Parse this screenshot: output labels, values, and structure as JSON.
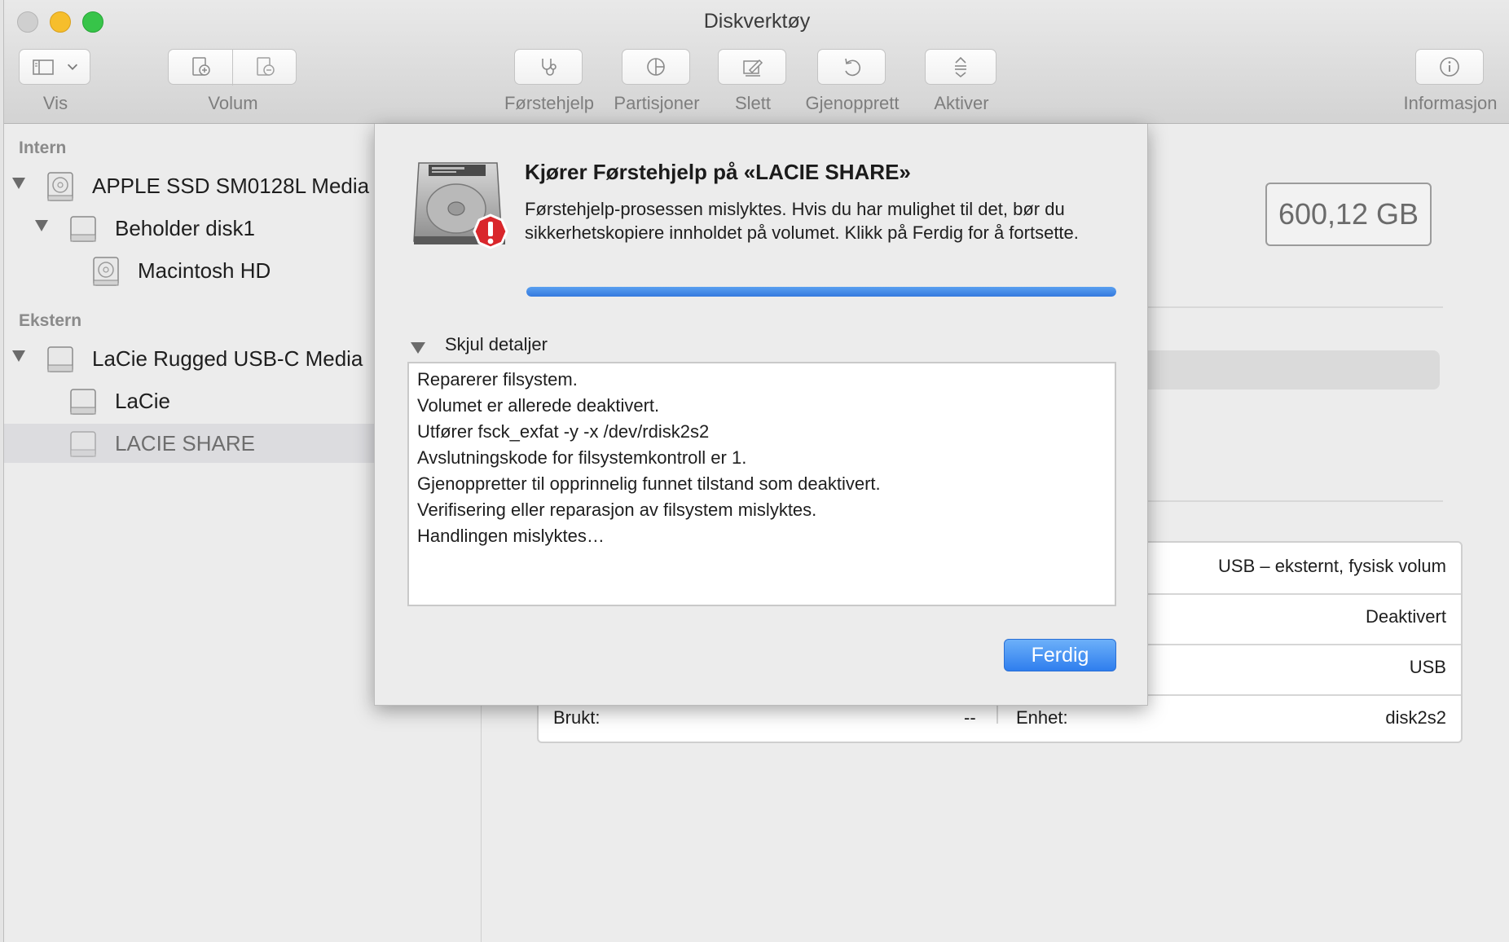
{
  "window": {
    "title": "Diskverktøy"
  },
  "toolbar": {
    "view_label": "Vis",
    "volume_label": "Volum",
    "firstaid_label": "Førstehjelp",
    "partition_label": "Partisjoner",
    "erase_label": "Slett",
    "restore_label": "Gjenopprett",
    "mount_label": "Aktiver",
    "info_label": "Informasjon"
  },
  "sidebar": {
    "internal_header": "Intern",
    "external_header": "Ekstern",
    "internal_items": [
      {
        "label": "APPLE SSD SM0128L Media"
      },
      {
        "label": "Beholder disk1"
      },
      {
        "label": "Macintosh HD"
      }
    ],
    "external_items": [
      {
        "label": "LaCie Rugged USB-C Media"
      },
      {
        "label": "LaCie"
      },
      {
        "label": "LACIE SHARE"
      }
    ]
  },
  "main": {
    "capacity": "600,12 GB",
    "info_rows": [
      {
        "right_value": "USB – eksternt, fysisk volum"
      },
      {
        "right_value": "Deaktivert"
      },
      {
        "right_value": "USB"
      },
      {
        "left_label": "Brukt:",
        "left_value": "--",
        "right_label": "Enhet:",
        "right_value": "disk2s2"
      }
    ]
  },
  "sheet": {
    "title": "Kjører Førstehjelp på «LACIE SHARE»",
    "message": "Førstehjelp-prosessen mislyktes. Hvis du har mulighet til det, bør du sikkerhetskopiere innholdet på volumet. Klikk på Ferdig for å fortsette.",
    "progress_fraction": 1.0,
    "details_toggle": "Skjul detaljer",
    "log": [
      "Reparerer filsystem.",
      "Volumet er allerede deaktivert.",
      "Utfører fsck_exfat -y -x /dev/rdisk2s2",
      "Avslutningskode for filsystemkontroll er 1.",
      "Gjenoppretter til opprinnelig funnet tilstand som deaktivert.",
      "Verifisering eller reparasjon av filsystem mislyktes.",
      "Handlingen mislyktes…"
    ],
    "done_button": "Ferdig"
  },
  "colors": {
    "accent": "#3479de",
    "alert": "#d9262b"
  }
}
